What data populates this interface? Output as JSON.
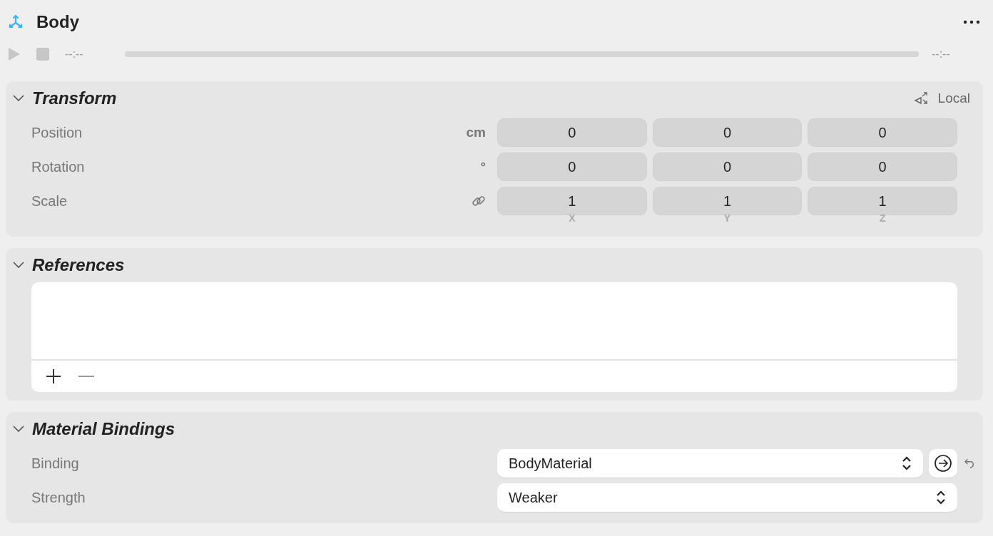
{
  "header": {
    "title": "Body"
  },
  "timeline": {
    "elapsed": "--:--",
    "remaining": "--:--",
    "playing": false
  },
  "transform": {
    "title": "Transform",
    "expanded": true,
    "space": "Local",
    "rows": [
      {
        "label": "Position",
        "kind": "text",
        "unit": "cm",
        "values": [
          "0",
          "0",
          "0"
        ]
      },
      {
        "label": "Rotation",
        "kind": "text",
        "unit": "°",
        "values": [
          "0",
          "0",
          "0"
        ]
      },
      {
        "label": "Scale",
        "kind": "link",
        "values": [
          "1",
          "1",
          "1"
        ]
      }
    ],
    "axes": [
      "X",
      "Y",
      "Z"
    ]
  },
  "references": {
    "title": "References",
    "expanded": true
  },
  "material": {
    "title": "Material Bindings",
    "expanded": true,
    "rows": [
      {
        "label": "Binding",
        "value": "BodyMaterial",
        "kind": "binding"
      },
      {
        "label": "Strength",
        "value": "Weaker",
        "kind": "plain"
      }
    ]
  }
}
